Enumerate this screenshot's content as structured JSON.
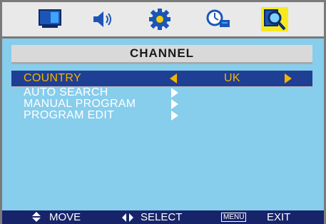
{
  "tabs": [
    {
      "icon": "picture-icon",
      "active": false
    },
    {
      "icon": "speaker-icon",
      "active": false
    },
    {
      "icon": "gear-icon",
      "active": false
    },
    {
      "icon": "clock-icon",
      "active": false
    },
    {
      "icon": "channel-search-icon",
      "active": true
    }
  ],
  "title": "CHANNEL",
  "menu": {
    "items": [
      {
        "label": "COUNTRY",
        "value": "UK",
        "selected": true
      },
      {
        "label": "AUTO SEARCH",
        "selected": false
      },
      {
        "label": "MANUAL PROGRAM",
        "selected": false
      },
      {
        "label": "PROGRAM EDIT",
        "selected": false
      }
    ]
  },
  "help": {
    "move": "MOVE",
    "select": "SELECT",
    "menu_key": "MENU",
    "exit": "EXIT"
  },
  "colors": {
    "panel_bg": "#87cdec",
    "highlight_bg": "#1e3f93",
    "highlight_text": "#f6b400",
    "helpbar_bg": "#17246a",
    "active_tab": "#f6ea1f"
  }
}
